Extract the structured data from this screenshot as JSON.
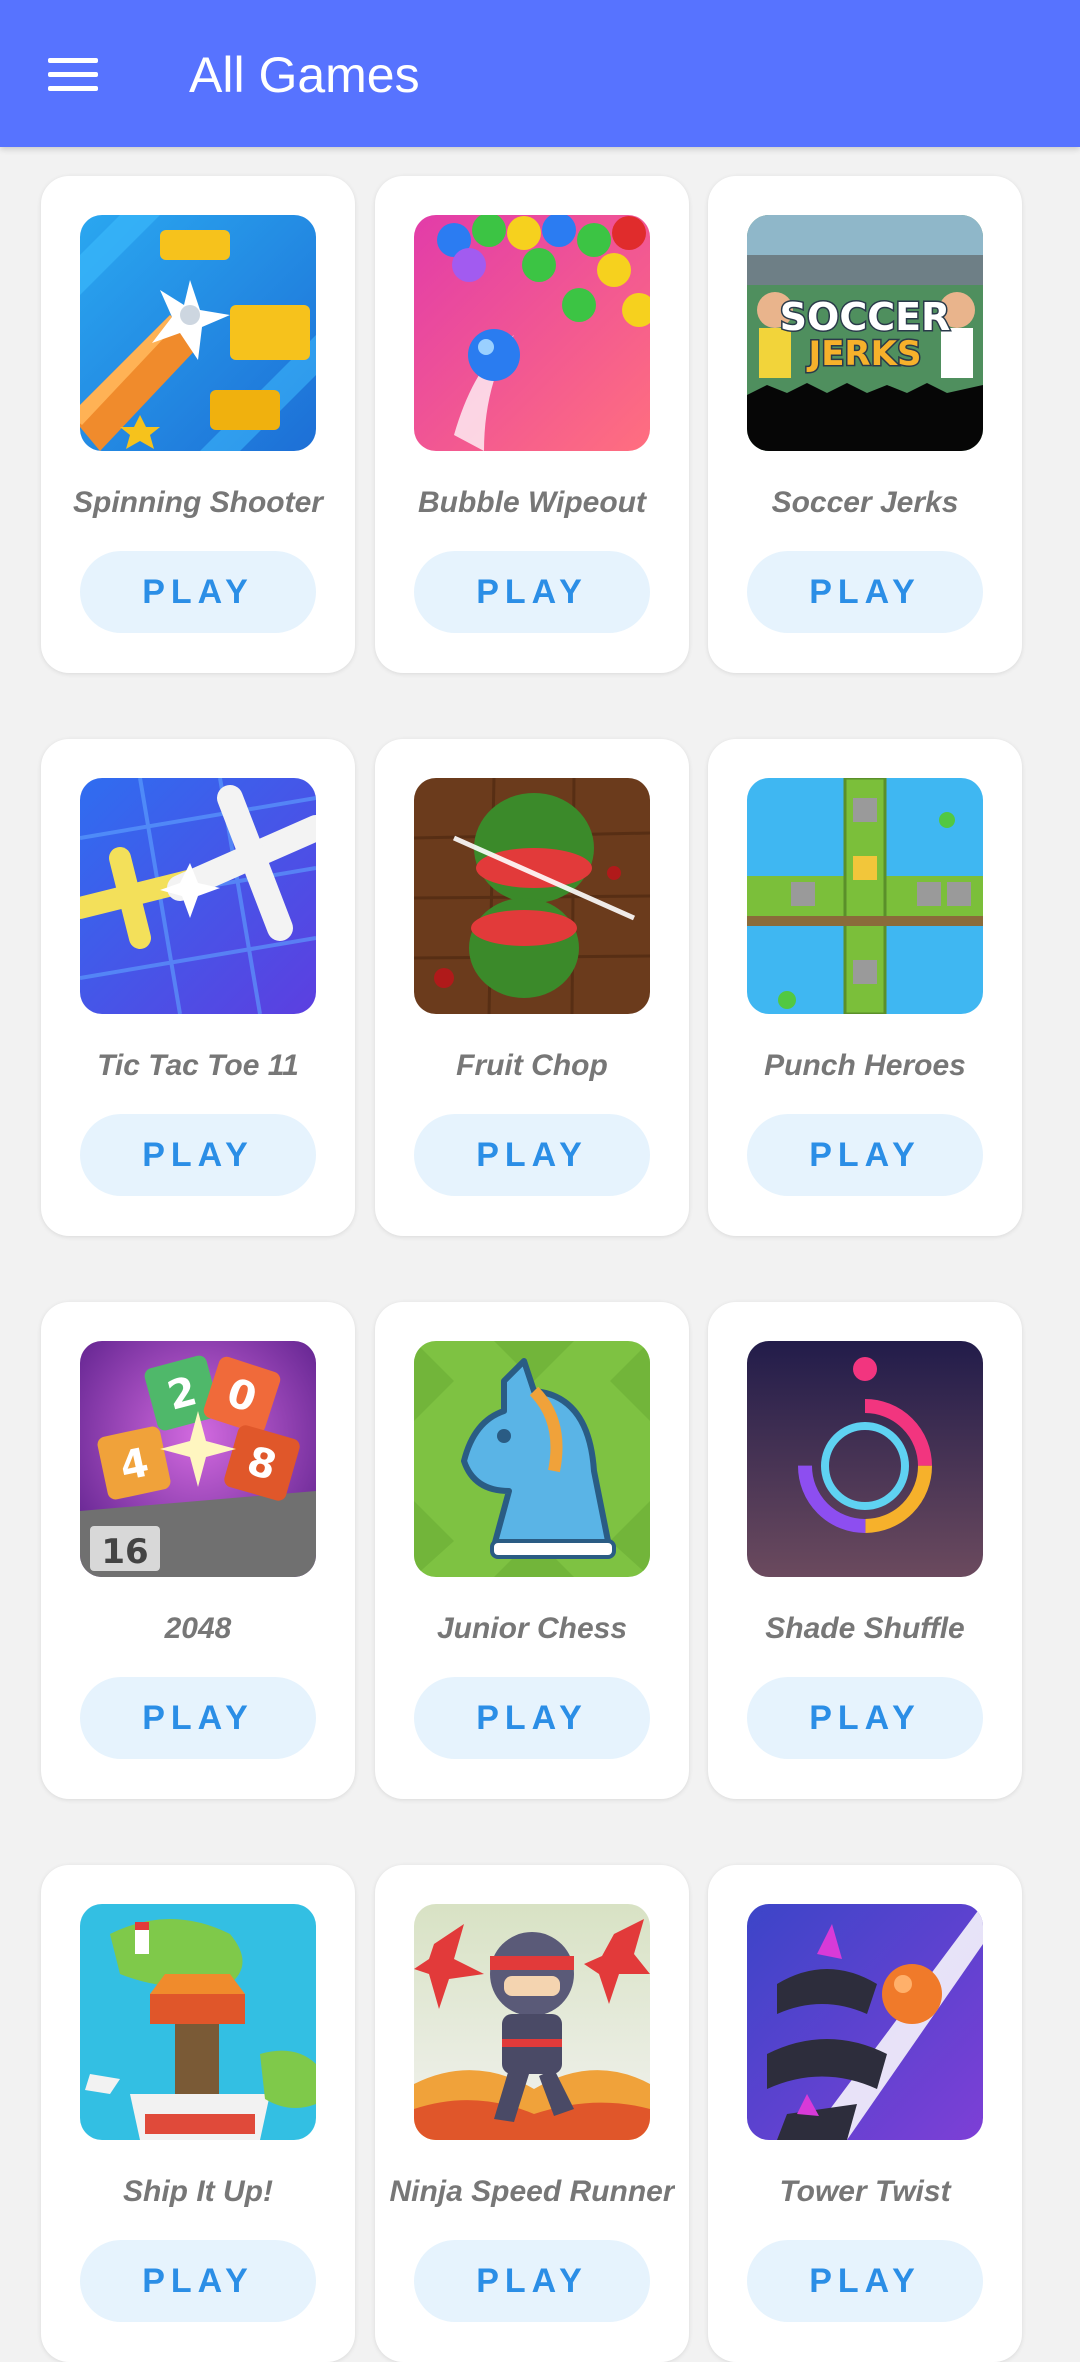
{
  "header": {
    "title": "All Games",
    "menu_icon": "hamburger-menu-icon"
  },
  "colors": {
    "appbar": "#5773ff",
    "background": "#f2f2f2",
    "card": "#ffffff",
    "play_button_bg": "#e6f3fd",
    "play_button_text": "#2b8ee6",
    "game_name_text": "#777777"
  },
  "games": [
    {
      "name": "Spinning Shooter",
      "play_label": "PLAY"
    },
    {
      "name": "Bubble Wipeout",
      "play_label": "PLAY"
    },
    {
      "name": "Soccer Jerks",
      "play_label": "PLAY"
    },
    {
      "name": "Tic Tac Toe 11",
      "play_label": "PLAY"
    },
    {
      "name": "Fruit Chop",
      "play_label": "PLAY"
    },
    {
      "name": "Punch Heroes",
      "play_label": "PLAY"
    },
    {
      "name": "2048",
      "play_label": "PLAY"
    },
    {
      "name": "Junior Chess",
      "play_label": "PLAY"
    },
    {
      "name": "Shade Shuffle",
      "play_label": "PLAY"
    },
    {
      "name": "Ship It Up!",
      "play_label": "PLAY"
    },
    {
      "name": "Ninja Speed Runner",
      "play_label": "PLAY"
    },
    {
      "name": "Tower Twist",
      "play_label": "PLAY"
    }
  ],
  "thumb_texts": {
    "soccer_line1": "SOCCER",
    "soccer_line2": "JERKS",
    "tile_2": "2",
    "tile_0": "0",
    "tile_8": "8",
    "tile_4": "4",
    "tile_16": "16"
  }
}
